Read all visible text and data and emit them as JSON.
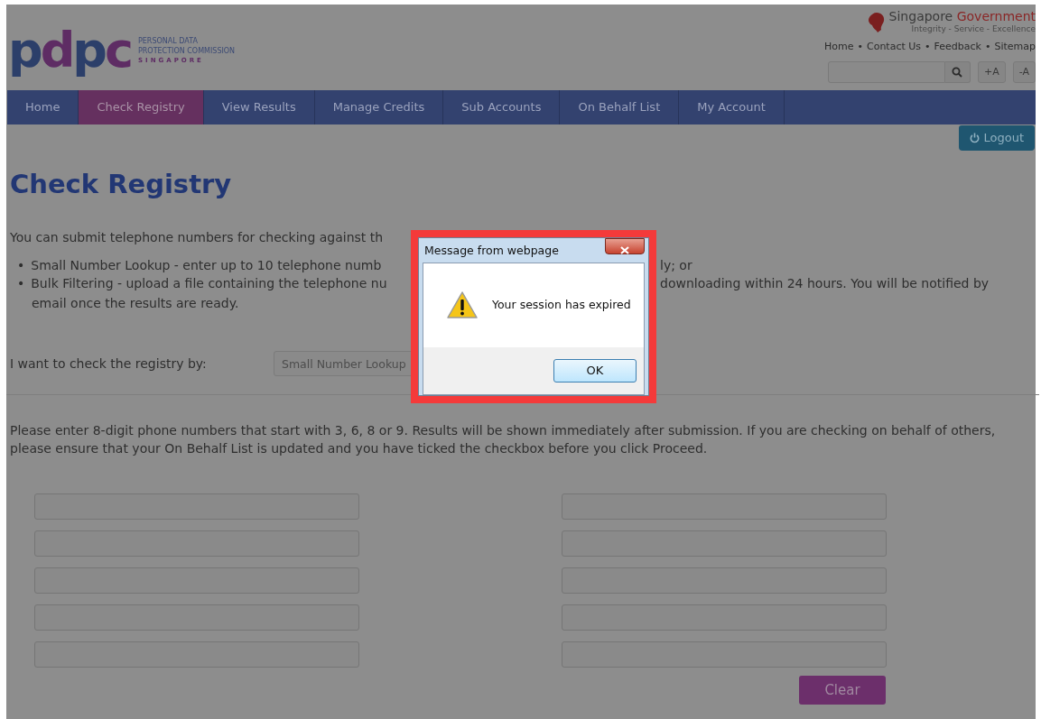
{
  "header": {
    "logo": {
      "mark": "pdpc",
      "lines": [
        "PERSONAL DATA",
        "PROTECTION COMMISSION",
        "SINGAPORE"
      ]
    },
    "government": {
      "name": "Singapore",
      "name_highlight": "Government",
      "tagline": "Integrity - Service - Excellence"
    },
    "top_links": [
      "Home",
      "Contact Us",
      "Feedback",
      "Sitemap"
    ],
    "link_separator": "•",
    "font_buttons": [
      "+A",
      "-A"
    ]
  },
  "nav": [
    {
      "label": "Home",
      "selected": false
    },
    {
      "label": "Check Registry",
      "selected": true
    },
    {
      "label": "View Results",
      "selected": false
    },
    {
      "label": "Manage Credits",
      "selected": false
    },
    {
      "label": "Sub Accounts",
      "selected": false
    },
    {
      "label": "On Behalf List",
      "selected": false
    },
    {
      "label": "My Account",
      "selected": false
    }
  ],
  "logout": "Logout",
  "title": "Check Registry",
  "intro": "You can submit telephone numbers for checking against th",
  "options": [
    {
      "bullet": "•",
      "left": "Small Number Lookup - enter up to 10 telephone numb",
      "right": "ly; or"
    },
    {
      "bullet": "•",
      "left": "Bulk Filtering - upload a file containing the telephone nu",
      "right": "downloading within 24 hours. You will be notified by",
      "continuation": "email once the results are ready."
    }
  ],
  "check_by": {
    "label": "I want to check the registry by:",
    "value": "Small Number Lookup"
  },
  "instructions": "Please enter 8-digit phone numbers that start with 3, 6, 8 or 9. Results will be shown immediately after submission. If you are checking on behalf of others, please ensure that your On Behalf List is updated and you have ticked the checkbox before you click Proceed.",
  "phone_fields": [
    {
      "kind": "input"
    },
    {
      "kind": "input"
    },
    {
      "kind": "input"
    },
    {
      "kind": "input"
    },
    {
      "kind": "input"
    },
    {
      "kind": "input"
    },
    {
      "kind": "input"
    },
    {
      "kind": "input"
    },
    {
      "kind": "input"
    },
    {
      "kind": "input"
    }
  ],
  "clear_button": "Clear",
  "dialog": {
    "title": "Message from webpage",
    "message": "Your session has expired",
    "button": "OK"
  }
}
